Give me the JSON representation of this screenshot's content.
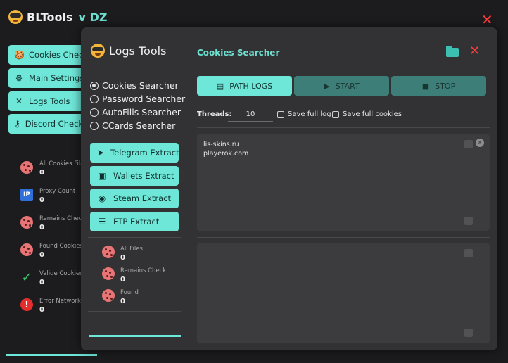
{
  "app": {
    "name": "BLTools",
    "version": "v DZ"
  },
  "main_close_label": "✕",
  "nav": [
    {
      "label": "Cookies Checker",
      "icon": "cookie-icon"
    },
    {
      "label": "Main Settings",
      "icon": "sliders-icon"
    },
    {
      "label": "Logs Tools",
      "icon": "tools-icon"
    },
    {
      "label": "Discord Checker",
      "icon": "key-icon"
    }
  ],
  "main_stats": [
    {
      "label": "All Cookies Files",
      "value": "0",
      "icon": "cookie-icon"
    },
    {
      "label": "Proxy Count",
      "value": "0",
      "icon": "ip-icon",
      "icon_text": "IP"
    },
    {
      "label": "Remains Check",
      "value": "0",
      "icon": "cookie-minus-icon"
    },
    {
      "label": "Found Cookies",
      "value": "0",
      "icon": "cookie-check-icon"
    },
    {
      "label": "Valide Cookies",
      "value": "0",
      "icon": "checkmark-icon",
      "icon_text": "✓"
    },
    {
      "label": "Error Networks",
      "value": "0",
      "icon": "error-icon",
      "icon_text": "!"
    }
  ],
  "dialog": {
    "title": "Logs Tools",
    "close_label": "✕",
    "modes": [
      {
        "label": "Cookies Searcher",
        "selected": true
      },
      {
        "label": "Password Searcher",
        "selected": false
      },
      {
        "label": "AutoFills Searcher",
        "selected": false
      },
      {
        "label": "CCards Searcher",
        "selected": false
      }
    ],
    "extract_buttons": [
      {
        "label": "Telegram Extract",
        "icon": "telegram-icon"
      },
      {
        "label": "Wallets Extract",
        "icon": "wallet-icon"
      },
      {
        "label": "Steam Extract",
        "icon": "steam-icon"
      },
      {
        "label": "FTP Extract",
        "icon": "server-icon"
      }
    ],
    "stats": [
      {
        "label": "All Files",
        "value": "0",
        "icon": "cookie-icon"
      },
      {
        "label": "Remains Check",
        "value": "0",
        "icon": "cookie-minus-icon"
      },
      {
        "label": "Found",
        "value": "0",
        "icon": "cookie-check-icon"
      }
    ],
    "searcher": {
      "title": "Cookies Searcher",
      "path_button": "PATH LOGS",
      "start_button": "START",
      "stop_button": "STOP",
      "threads_label": "Threads:",
      "threads_value": "10",
      "save_full_log": "Save full log",
      "save_full_cookies": "Save full cookies",
      "query_lines": [
        "lis-skins.ru",
        "playerok.com"
      ],
      "clear_icon_label": "×"
    }
  },
  "colors": {
    "accent": "#6ee6d8",
    "accent_muted": "#3d7f78",
    "background": "#1c1c1e",
    "panel": "#323234",
    "close_red": "#ff3b3b",
    "title_accent": "#6ee0d0"
  }
}
